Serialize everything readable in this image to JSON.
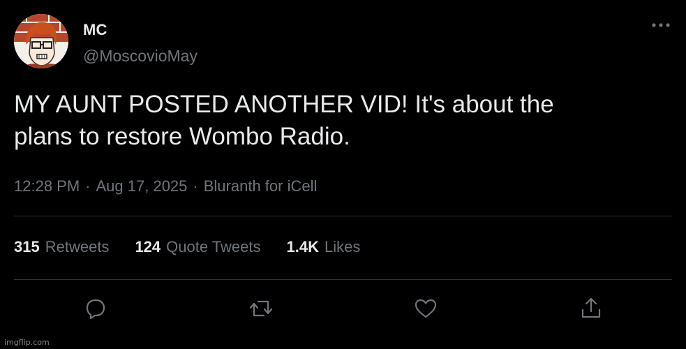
{
  "tweet": {
    "display_name": "MC",
    "handle": "@MoscovioMay",
    "text_lines": [
      "MY AUNT POSTED ANOTHER VID! It's about the",
      "plans to restore Wombo Radio."
    ],
    "time": "12:28 PM",
    "date": "Aug 17, 2025",
    "separator": "·",
    "source": "Bluranth for iCell",
    "more_label": "···"
  },
  "stats": [
    {
      "count": "315",
      "label": "Retweets"
    },
    {
      "count": "124",
      "label": "Quote Tweets"
    },
    {
      "count": "1.4K",
      "label": "Likes"
    }
  ],
  "actions": [
    {
      "icon": "reply-icon"
    },
    {
      "icon": "retweet-icon"
    },
    {
      "icon": "like-icon"
    },
    {
      "icon": "share-icon"
    }
  ],
  "watermark": "imgflip.com",
  "colors": {
    "background": "#000000",
    "primary_text": "#e7e9ea",
    "secondary_text": "#71767b",
    "divider": "#2f3336"
  }
}
